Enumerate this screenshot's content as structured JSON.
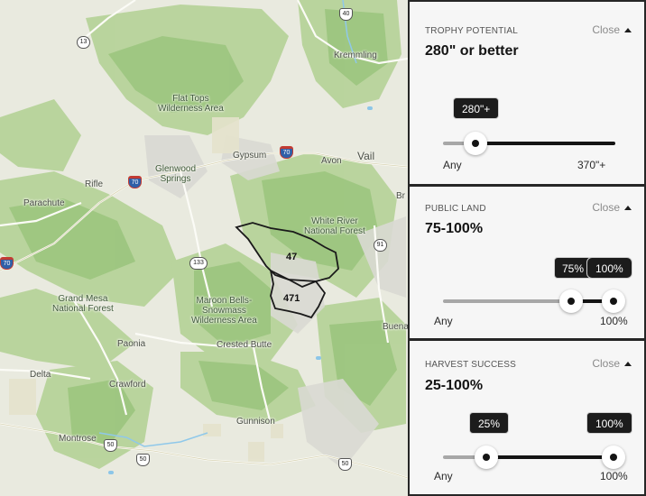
{
  "map": {
    "places": {
      "kremmling": "Kremmling",
      "flat_tops": "Flat Tops\nWilderness Area",
      "gypsum": "Gypsum",
      "avon": "Avon",
      "vail": "Vail",
      "glenwood": "Glenwood\nSprings",
      "rifle": "Rifle",
      "parachute": "Parachute",
      "white_river": "White River\nNational Forest",
      "grand_mesa": "Grand Mesa\nNational Forest",
      "maroon_bells": "Maroon Bells-\nSnowmass\nWilderness Area",
      "paonia": "Paonia",
      "crested_butte": "Crested Butte",
      "delta": "Delta",
      "crawford": "Crawford",
      "gunnison": "Gunnison",
      "montrose": "Montrose",
      "buena": "Buena",
      "br": "Br"
    },
    "shields": {
      "s40": "40",
      "s13": "13",
      "i70_east": "70",
      "i70_west": "70",
      "i70_edge": "70",
      "s91": "91",
      "s133": "133",
      "s50a": "50",
      "s50b": "50",
      "s50c": "50"
    },
    "units": {
      "unit_47": "47",
      "unit_471": "471"
    }
  },
  "filters": {
    "trophy": {
      "heading": "TROPHY POTENTIAL",
      "close_label": "Close",
      "value": "280\" or better",
      "bubble": "280\"+",
      "min_label": "Any",
      "max_label": "370\"+",
      "fraction": 0.18
    },
    "public_land": {
      "heading": "PUBLIC LAND",
      "close_label": "Close",
      "value": "75-100%",
      "bubble_low": "75%",
      "bubble_high": "100%",
      "min_label": "Any",
      "max_label": "100%",
      "low_fraction": 0.75,
      "high_fraction": 1.0
    },
    "harvest": {
      "heading": "HARVEST SUCCESS",
      "close_label": "Close",
      "value": "25-100%",
      "bubble_low": "25%",
      "bubble_high": "100%",
      "min_label": "Any",
      "max_label": "100%",
      "low_fraction": 0.25,
      "high_fraction": 1.0
    }
  }
}
